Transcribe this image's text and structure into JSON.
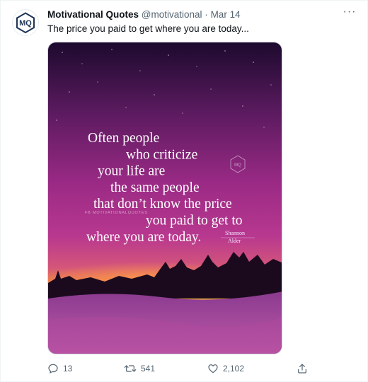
{
  "tweet": {
    "avatar_text": "MQ",
    "display_name": "Motivational Quotes",
    "handle": "@motivational",
    "separator": "·",
    "date": "Mar 14",
    "more_label": "···",
    "text": "The price you paid to get where you are today..."
  },
  "image": {
    "quote_lines": [
      "Often people",
      "who criticize",
      "your life are",
      "the same people",
      "that don’t know the price",
      "you paid to get to",
      "where you are today."
    ],
    "author_first": "Shannon",
    "author_last": "Alder",
    "watermark_logo": "MQ",
    "watermark_text": "FB MOTIVATIONALQUOTES"
  },
  "actions": {
    "replies": "13",
    "retweets": "541",
    "likes": "2,102"
  },
  "colors": {
    "text_primary": "#0f1419",
    "text_secondary": "#536471",
    "border": "#eff3f4",
    "avatar_ring": "#cfd9de"
  }
}
